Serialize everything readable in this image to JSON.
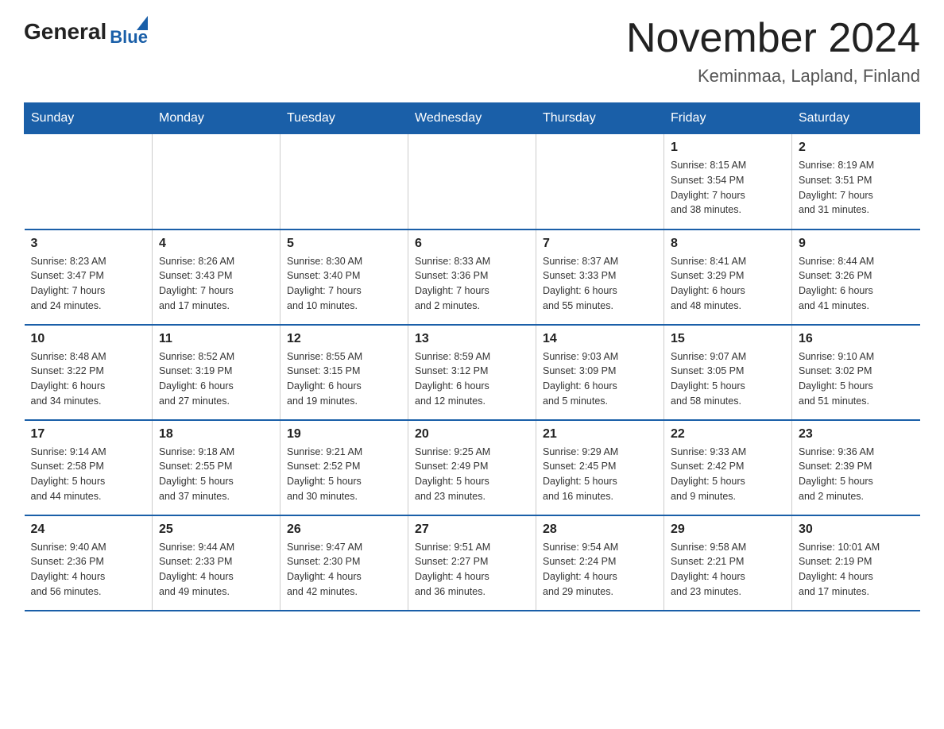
{
  "logo": {
    "general": "General",
    "blue": "Blue"
  },
  "title": "November 2024",
  "subtitle": "Keminmaa, Lapland, Finland",
  "weekdays": [
    "Sunday",
    "Monday",
    "Tuesday",
    "Wednesday",
    "Thursday",
    "Friday",
    "Saturday"
  ],
  "weeks": [
    [
      {
        "day": "",
        "info": ""
      },
      {
        "day": "",
        "info": ""
      },
      {
        "day": "",
        "info": ""
      },
      {
        "day": "",
        "info": ""
      },
      {
        "day": "",
        "info": ""
      },
      {
        "day": "1",
        "info": "Sunrise: 8:15 AM\nSunset: 3:54 PM\nDaylight: 7 hours\nand 38 minutes."
      },
      {
        "day": "2",
        "info": "Sunrise: 8:19 AM\nSunset: 3:51 PM\nDaylight: 7 hours\nand 31 minutes."
      }
    ],
    [
      {
        "day": "3",
        "info": "Sunrise: 8:23 AM\nSunset: 3:47 PM\nDaylight: 7 hours\nand 24 minutes."
      },
      {
        "day": "4",
        "info": "Sunrise: 8:26 AM\nSunset: 3:43 PM\nDaylight: 7 hours\nand 17 minutes."
      },
      {
        "day": "5",
        "info": "Sunrise: 8:30 AM\nSunset: 3:40 PM\nDaylight: 7 hours\nand 10 minutes."
      },
      {
        "day": "6",
        "info": "Sunrise: 8:33 AM\nSunset: 3:36 PM\nDaylight: 7 hours\nand 2 minutes."
      },
      {
        "day": "7",
        "info": "Sunrise: 8:37 AM\nSunset: 3:33 PM\nDaylight: 6 hours\nand 55 minutes."
      },
      {
        "day": "8",
        "info": "Sunrise: 8:41 AM\nSunset: 3:29 PM\nDaylight: 6 hours\nand 48 minutes."
      },
      {
        "day": "9",
        "info": "Sunrise: 8:44 AM\nSunset: 3:26 PM\nDaylight: 6 hours\nand 41 minutes."
      }
    ],
    [
      {
        "day": "10",
        "info": "Sunrise: 8:48 AM\nSunset: 3:22 PM\nDaylight: 6 hours\nand 34 minutes."
      },
      {
        "day": "11",
        "info": "Sunrise: 8:52 AM\nSunset: 3:19 PM\nDaylight: 6 hours\nand 27 minutes."
      },
      {
        "day": "12",
        "info": "Sunrise: 8:55 AM\nSunset: 3:15 PM\nDaylight: 6 hours\nand 19 minutes."
      },
      {
        "day": "13",
        "info": "Sunrise: 8:59 AM\nSunset: 3:12 PM\nDaylight: 6 hours\nand 12 minutes."
      },
      {
        "day": "14",
        "info": "Sunrise: 9:03 AM\nSunset: 3:09 PM\nDaylight: 6 hours\nand 5 minutes."
      },
      {
        "day": "15",
        "info": "Sunrise: 9:07 AM\nSunset: 3:05 PM\nDaylight: 5 hours\nand 58 minutes."
      },
      {
        "day": "16",
        "info": "Sunrise: 9:10 AM\nSunset: 3:02 PM\nDaylight: 5 hours\nand 51 minutes."
      }
    ],
    [
      {
        "day": "17",
        "info": "Sunrise: 9:14 AM\nSunset: 2:58 PM\nDaylight: 5 hours\nand 44 minutes."
      },
      {
        "day": "18",
        "info": "Sunrise: 9:18 AM\nSunset: 2:55 PM\nDaylight: 5 hours\nand 37 minutes."
      },
      {
        "day": "19",
        "info": "Sunrise: 9:21 AM\nSunset: 2:52 PM\nDaylight: 5 hours\nand 30 minutes."
      },
      {
        "day": "20",
        "info": "Sunrise: 9:25 AM\nSunset: 2:49 PM\nDaylight: 5 hours\nand 23 minutes."
      },
      {
        "day": "21",
        "info": "Sunrise: 9:29 AM\nSunset: 2:45 PM\nDaylight: 5 hours\nand 16 minutes."
      },
      {
        "day": "22",
        "info": "Sunrise: 9:33 AM\nSunset: 2:42 PM\nDaylight: 5 hours\nand 9 minutes."
      },
      {
        "day": "23",
        "info": "Sunrise: 9:36 AM\nSunset: 2:39 PM\nDaylight: 5 hours\nand 2 minutes."
      }
    ],
    [
      {
        "day": "24",
        "info": "Sunrise: 9:40 AM\nSunset: 2:36 PM\nDaylight: 4 hours\nand 56 minutes."
      },
      {
        "day": "25",
        "info": "Sunrise: 9:44 AM\nSunset: 2:33 PM\nDaylight: 4 hours\nand 49 minutes."
      },
      {
        "day": "26",
        "info": "Sunrise: 9:47 AM\nSunset: 2:30 PM\nDaylight: 4 hours\nand 42 minutes."
      },
      {
        "day": "27",
        "info": "Sunrise: 9:51 AM\nSunset: 2:27 PM\nDaylight: 4 hours\nand 36 minutes."
      },
      {
        "day": "28",
        "info": "Sunrise: 9:54 AM\nSunset: 2:24 PM\nDaylight: 4 hours\nand 29 minutes."
      },
      {
        "day": "29",
        "info": "Sunrise: 9:58 AM\nSunset: 2:21 PM\nDaylight: 4 hours\nand 23 minutes."
      },
      {
        "day": "30",
        "info": "Sunrise: 10:01 AM\nSunset: 2:19 PM\nDaylight: 4 hours\nand 17 minutes."
      }
    ]
  ]
}
